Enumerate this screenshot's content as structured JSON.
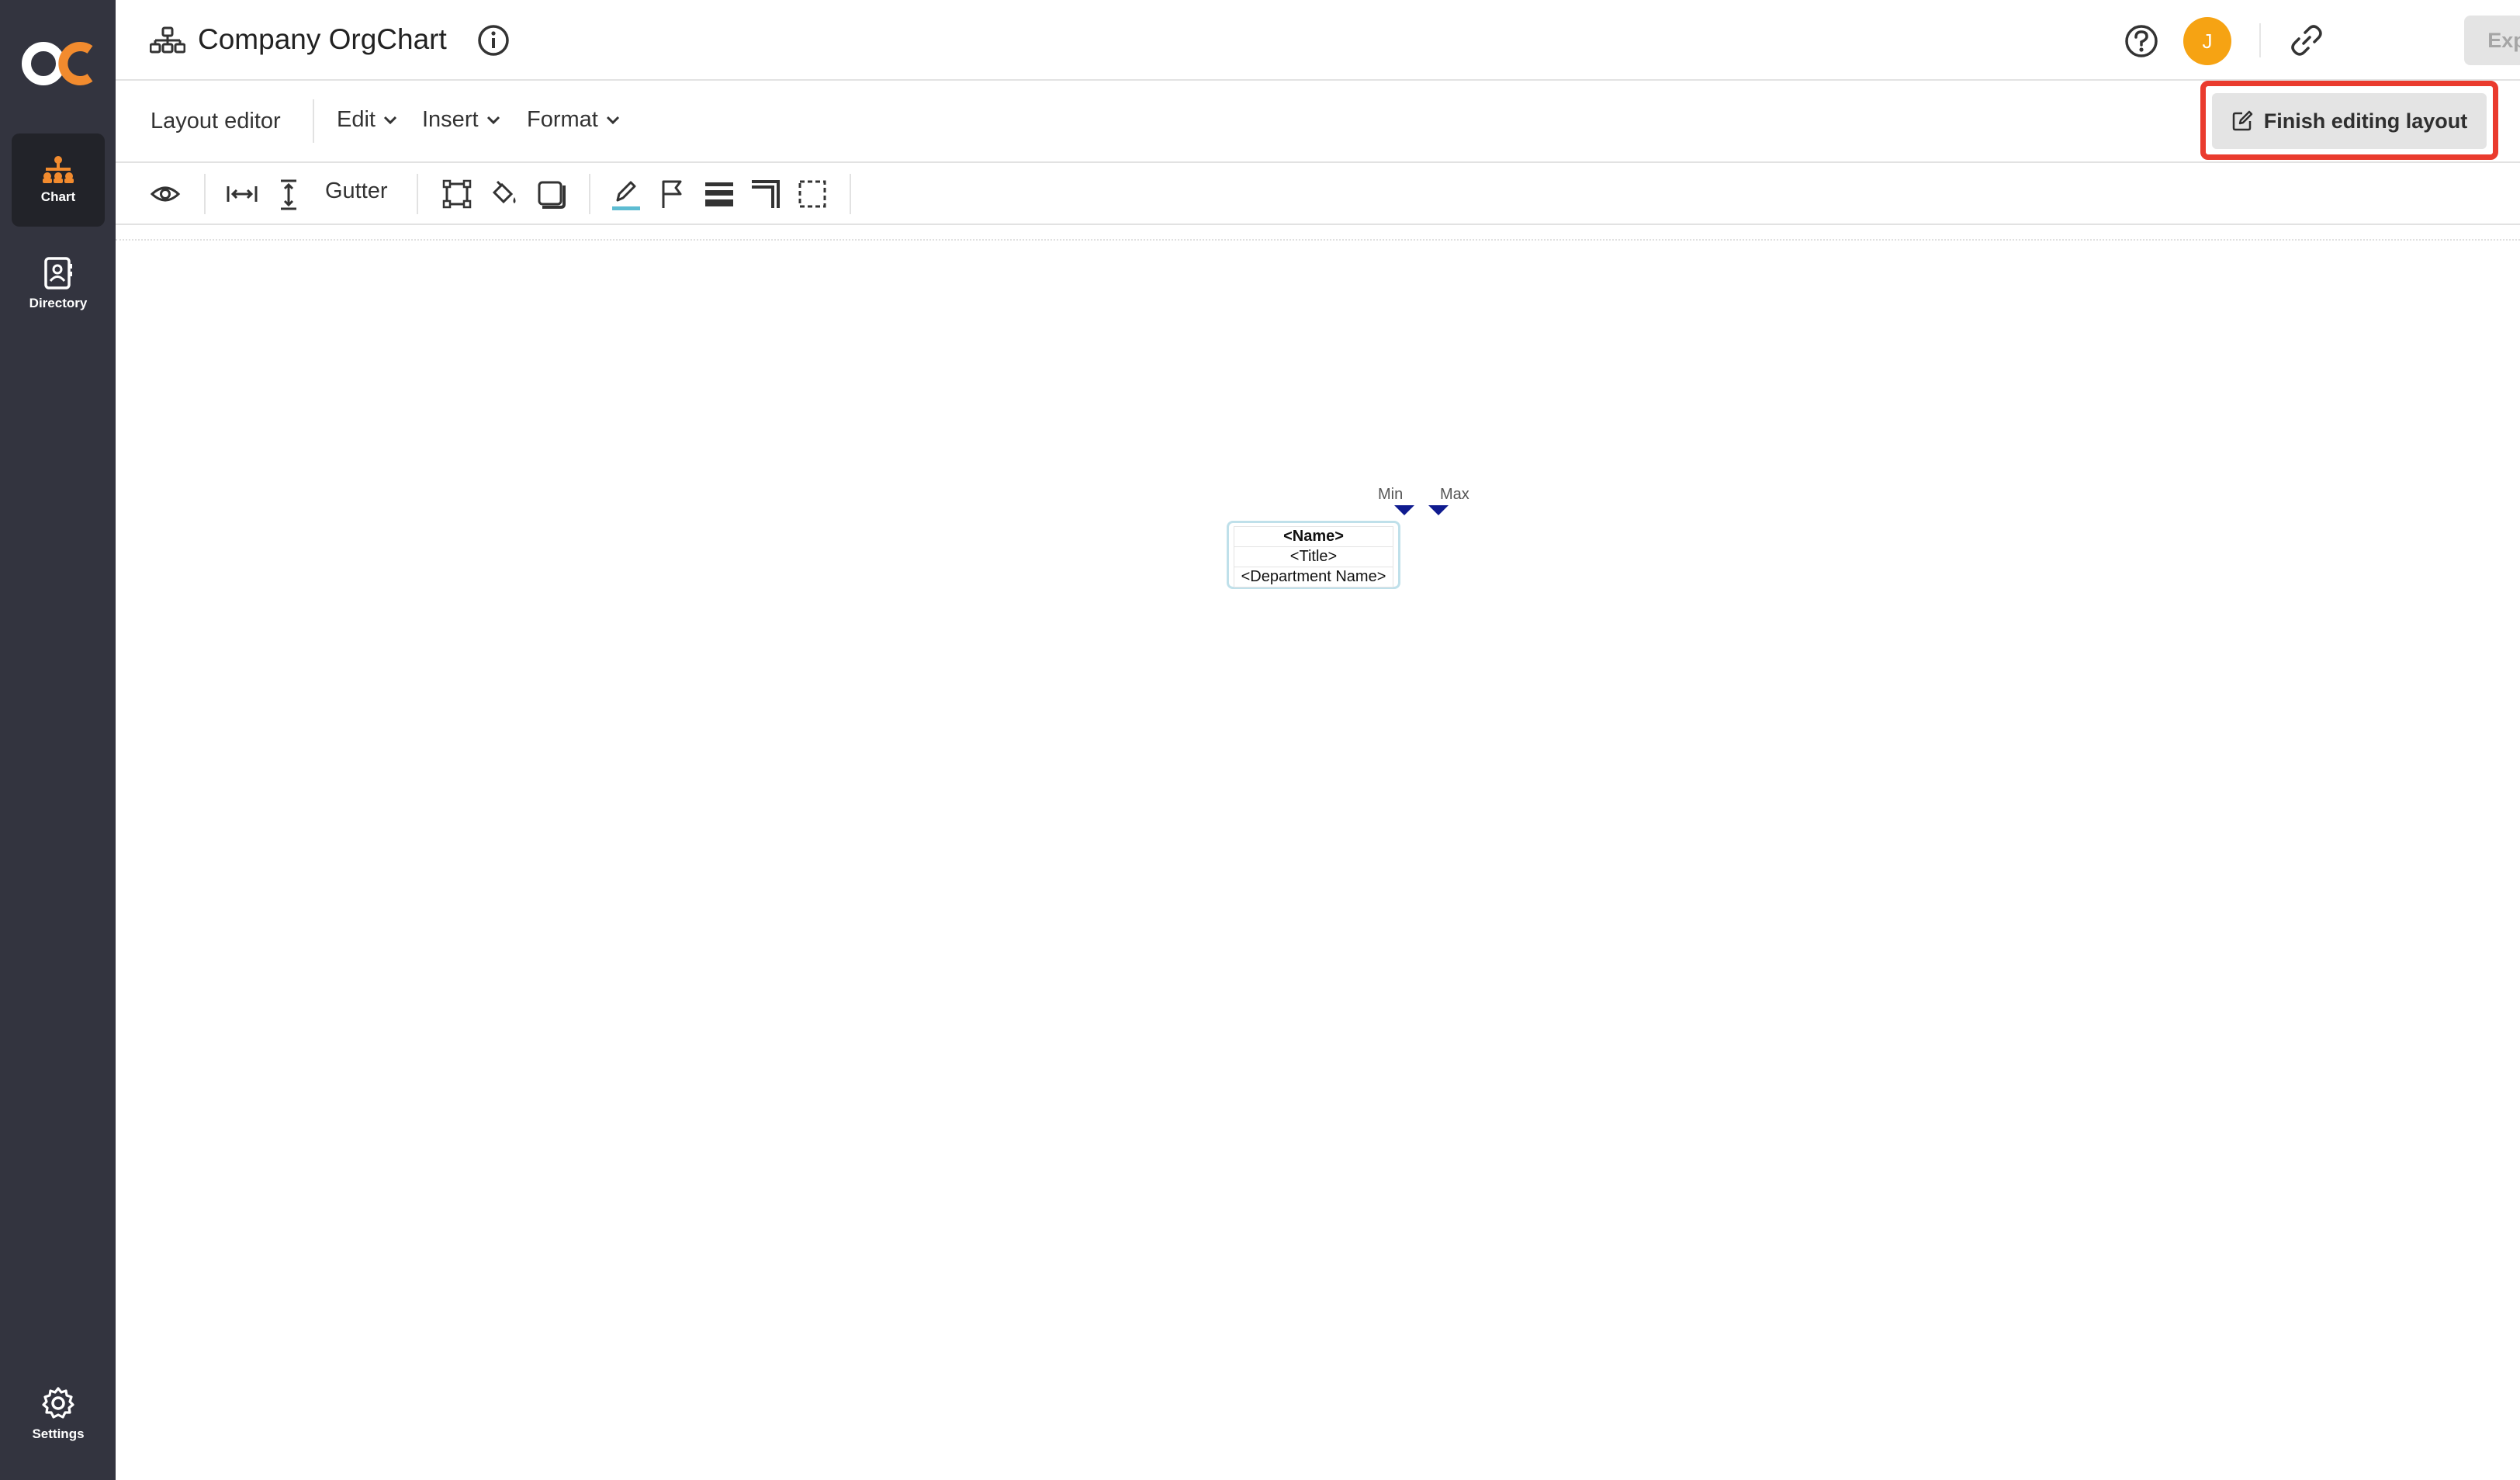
{
  "app": {
    "logo_text": "OC",
    "title": "Company OrgChart",
    "avatar_initial": "J",
    "export_label": "Export"
  },
  "sidebar": {
    "items": [
      {
        "label": "Chart",
        "icon": "org-chart-icon",
        "active": true
      },
      {
        "label": "Directory",
        "icon": "contact-book-icon",
        "active": false
      }
    ],
    "settings_label": "Settings"
  },
  "menubar": {
    "mode_label": "Layout editor",
    "menus": [
      {
        "label": "Edit"
      },
      {
        "label": "Insert"
      },
      {
        "label": "Format"
      }
    ],
    "finish_label": "Finish editing layout"
  },
  "toolbar": {
    "gutter_label": "Gutter",
    "tools": [
      "eye-icon",
      "horizontal-spacing-icon",
      "vertical-spacing-icon",
      "gutter",
      "box-shape-icon",
      "fill-color-icon",
      "shadow-box-icon",
      "line-color-icon",
      "flag-icon",
      "line-weight-icon",
      "corner-style-icon",
      "dashed-border-icon"
    ]
  },
  "canvas": {
    "min_label": "Min",
    "max_label": "Max",
    "card": {
      "name": "<Name>",
      "title": "<Title>",
      "department": "<Department Name>"
    }
  },
  "colors": {
    "sidebar": "#33343f",
    "sidebar_active": "#222329",
    "accent": "#f28b2e",
    "avatar": "#f6a313",
    "highlight": "#ea3b2e",
    "card_border": "#bfe0ea",
    "marker": "#0f1b8f"
  }
}
